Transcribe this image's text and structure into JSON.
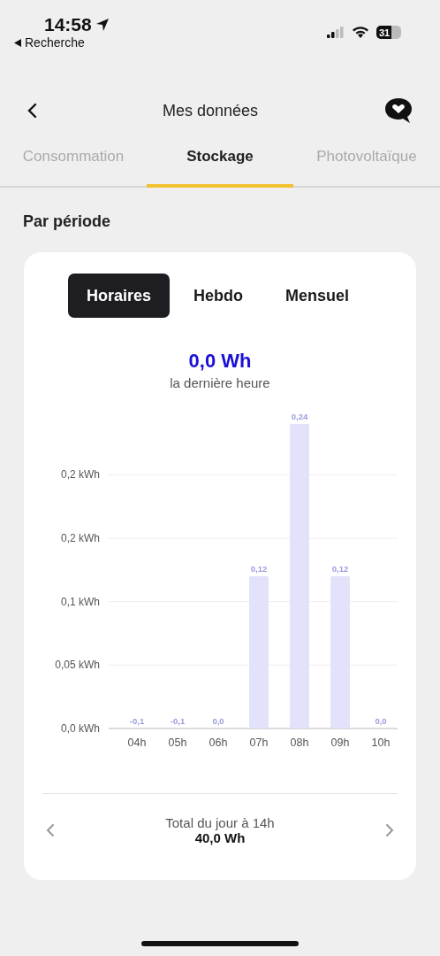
{
  "status_bar": {
    "time": "14:58",
    "back_label": "Recherche",
    "battery": "31"
  },
  "header": {
    "title": "Mes données"
  },
  "tabs": [
    {
      "label": "Consommation",
      "selected": false
    },
    {
      "label": "Stockage",
      "selected": true
    },
    {
      "label": "Photovoltaïque",
      "selected": false
    }
  ],
  "section_title": "Par période",
  "periods": [
    {
      "label": "Horaires",
      "selected": true
    },
    {
      "label": "Hebdo",
      "selected": false
    },
    {
      "label": "Mensuel",
      "selected": false
    }
  ],
  "summary": {
    "value": "0,0 Wh",
    "caption": "la dernière heure"
  },
  "chart_data": {
    "type": "bar",
    "categories": [
      "04h",
      "05h",
      "06h",
      "07h",
      "08h",
      "09h",
      "10h"
    ],
    "series": [
      {
        "color": "#e2e2fb",
        "values": [
          0,
          0,
          0,
          0.12,
          0.24,
          0.12,
          0
        ]
      }
    ],
    "value_labels": [
      "-0,1",
      "-0,1",
      "0,0",
      "0,12",
      "0,24",
      "0,12",
      "0,0"
    ],
    "ylim": [
      0,
      0.24
    ],
    "grid": true,
    "yticks": [
      {
        "value": 0,
        "label": "0,0 kWh"
      },
      {
        "value": 0.05,
        "label": "0,05 kWh"
      },
      {
        "value": 0.1,
        "label": "0,1 kWh"
      },
      {
        "value": 0.15,
        "label": "0,2 kWh"
      },
      {
        "value": 0.2,
        "label": "0,2 kWh"
      }
    ]
  },
  "footer": {
    "label": "Total du jour à 14h",
    "value": "40,0 Wh"
  }
}
